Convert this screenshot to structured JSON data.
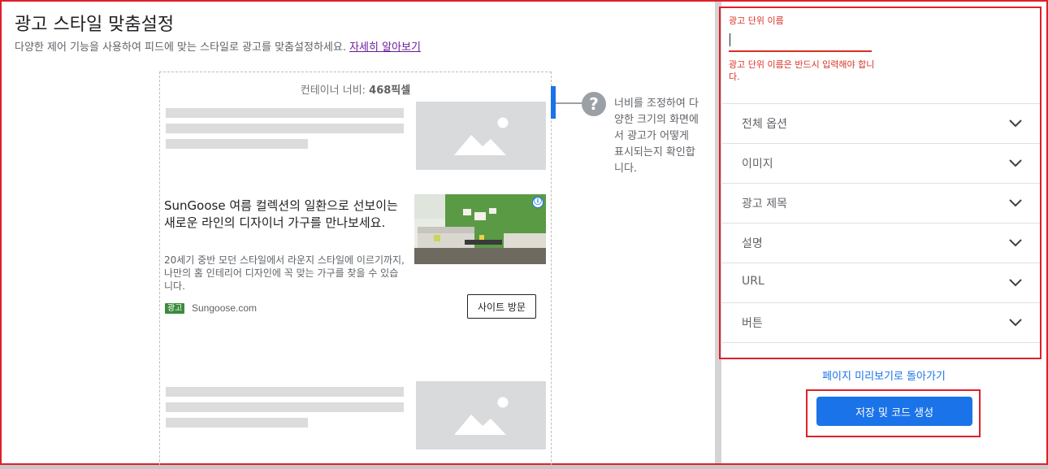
{
  "header": {
    "title": "광고 스타일 맞춤설정",
    "subtitle": "다양한 제어 기능을 사용하여 피드에 맞는 스타일로 광고를 맞춤설정하세요.",
    "learn_more": "자세히 알아보기"
  },
  "preview": {
    "container_width_prefix": "컨테이너 너비: ",
    "container_width_value": "468픽셀",
    "help_icon": "question-mark-icon",
    "help_text": "너비를 조정하여 다양한 크기의 화면에서 광고가 어떻게 표시되는지 확인합니다."
  },
  "ad": {
    "headline": "SunGoose 여름 컬렉션의 일환으로 선보이는 새로운 라인의 디자이너 가구를 만나보세요.",
    "description": "20세기 중반 모던 스타일에서 라운지 스타일에 이르기까지, 나만의 홈 인테리어 디자인에 꼭 맞는 가구를 찾을 수 있습니다.",
    "badge": "광고",
    "domain": "Sungoose.com",
    "cta": "사이트 방문",
    "info_icon": "ⓘ"
  },
  "settings": {
    "unit_name_label": "광고 단위 이름",
    "unit_name_value": "",
    "unit_name_error": "광고 단위 이름은 반드시 입력해야 합니다.",
    "sections": [
      {
        "label": "전체 옵션"
      },
      {
        "label": "이미지"
      },
      {
        "label": "광고 제목"
      },
      {
        "label": "설명"
      },
      {
        "label": "URL"
      },
      {
        "label": "버튼"
      }
    ],
    "back_link": "페이지 미리보기로 돌아가기",
    "save_button": "저장 및 코드 생성"
  },
  "colors": {
    "accent": "#1a73e8",
    "error": "#d93025",
    "highlight_border": "#e0202a",
    "ad_badge": "#3d8b3d"
  }
}
